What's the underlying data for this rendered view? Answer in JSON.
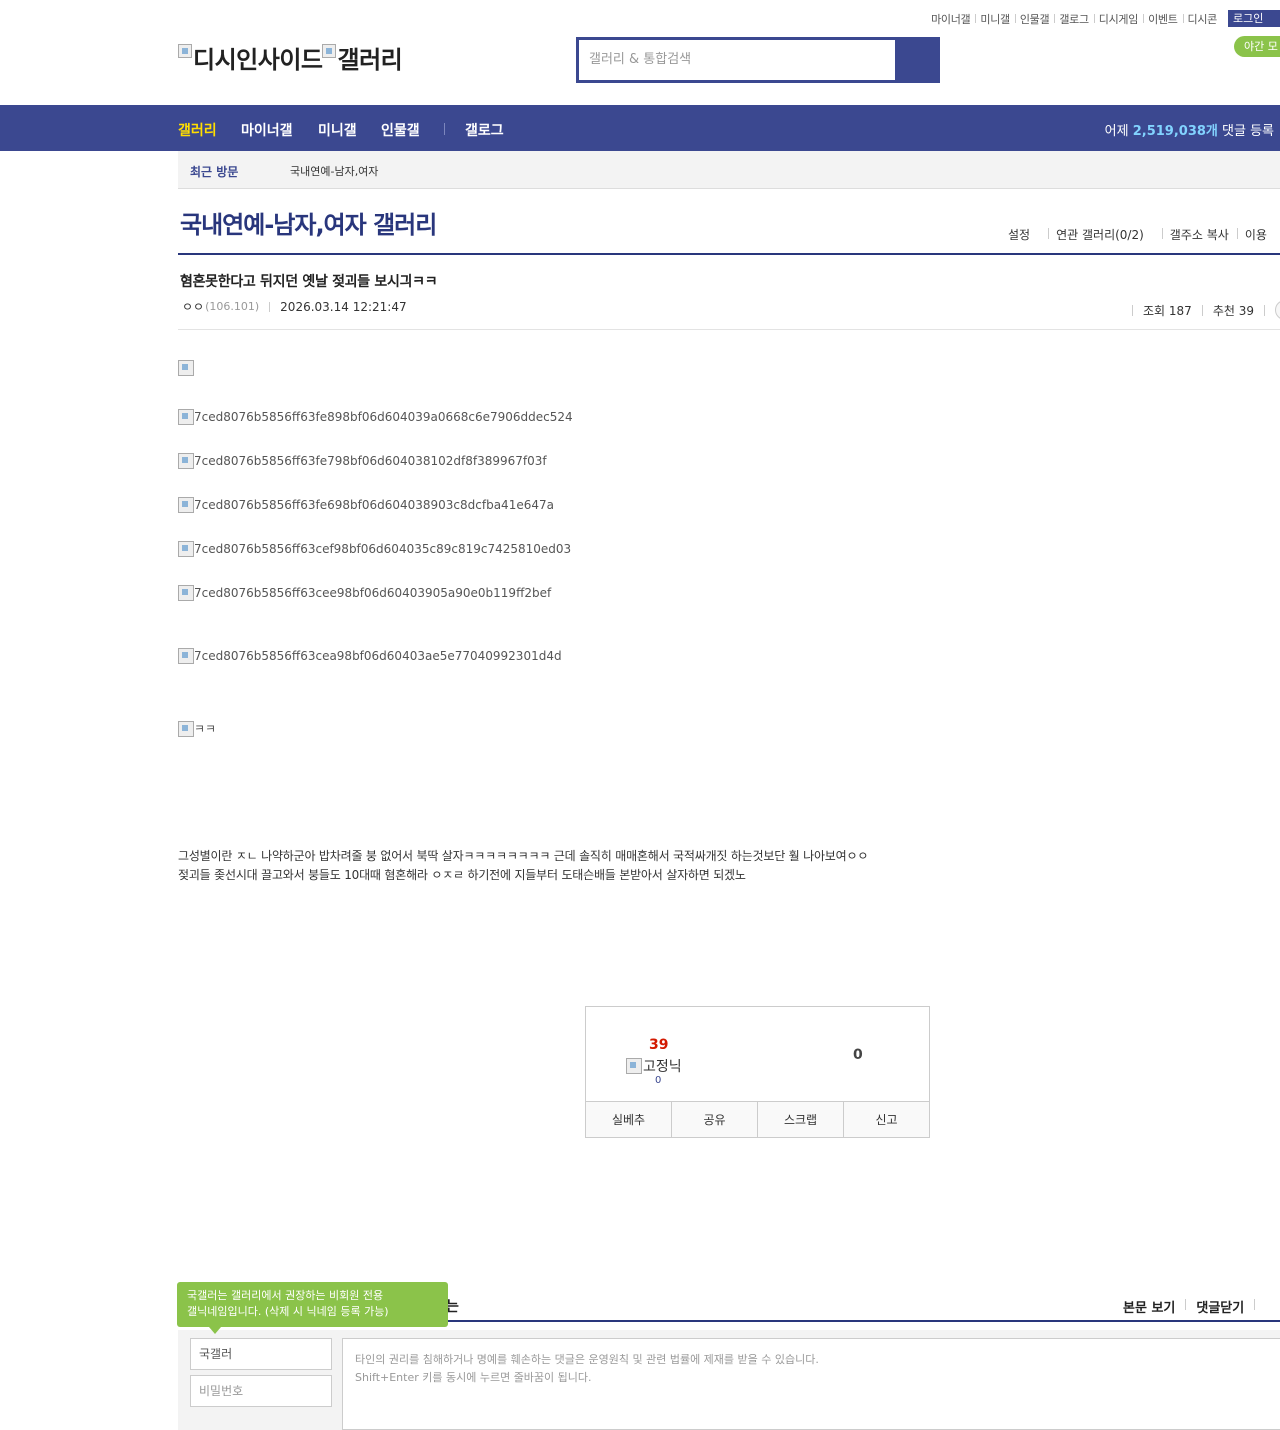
{
  "util": {
    "links": [
      "마이너갤",
      "미니갤",
      "인물갤",
      "갤로그",
      "디시게임",
      "이벤트",
      "디시콘"
    ],
    "login": "로그인",
    "night": "야간 모"
  },
  "logo": {
    "site": "디시인사이드",
    "gallery": "갤러리"
  },
  "search": {
    "placeholder": "갤러리 & 통합검색"
  },
  "nav": {
    "items": [
      "갤러리",
      "마이너갤",
      "미니갤",
      "인물갤",
      "갤로그"
    ],
    "stat_prefix": "어제 ",
    "stat_count": "2,519,038개",
    "stat_suffix": " 댓글 등록"
  },
  "recent": {
    "label": "최근 방문",
    "item": "국내연예-남자,여자"
  },
  "gallery": {
    "title": "국내연예-남자,여자 갤러리",
    "options": [
      "설정",
      "연관 갤러리(0/2)",
      "갤주소 복사",
      "이용"
    ]
  },
  "post": {
    "title": "혐혼못한다고 뒤지던 옛날 젖괴들 보시긔ㅋㅋ",
    "author": "ㅇㅇ",
    "ip": "(106.101)",
    "date": "2026.03.14 12:21:47",
    "views": "조회 187",
    "recommend": "추천 39",
    "images": [
      "7ced8076b5856ff63fe898bf06d604039a0668c6e7906ddec524",
      "7ced8076b5856ff63fe798bf06d604038102df8f389967f03f",
      "7ced8076b5856ff63fe698bf06d604038903c8dcfba41e647a",
      "7ced8076b5856ff63cef98bf06d604035c89c819c7425810ed03",
      "7ced8076b5856ff63cee98bf06d60403905a90e0b119ff2bef",
      "7ced8076b5856ff63cea98bf06d60403ae5e77040992301d4d",
      "ㅋㅋ"
    ],
    "body": [
      "그성별이란 ㅈㄴ 나약하군아 밥차려줄 붕 없어서 북딱 살자ㅋㅋㅋㅋㅋㅋㅋㅋ 근데 솔직히 매매혼해서 국적싸개짓 하는것보단 훨 나아보여ㅇㅇ",
      "젖괴들 좆선시대 끌고와서 붕들도 10대때 혐혼해라 ㅇㅈㄹ 하기전에 지들부터 도태슨배들 본받아서 살자하면 되겠노"
    ]
  },
  "recbox": {
    "up": "39",
    "fixed_label": "고정닉",
    "fixed_count": "0",
    "down": "0",
    "actions": [
      "실베추",
      "공유",
      "스크랩",
      "신고"
    ]
  },
  "comments": {
    "tooltip_line1": "국갤러는 갤러리에서 권장하는 비회원 전용",
    "tooltip_line2": "갤닉네임입니다. (삭제 시 닉네임 등록 가능)",
    "title_tail": "는",
    "links": [
      "본문 보기",
      "댓글닫기"
    ],
    "nick": "국갤러",
    "pw_placeholder": "비밀번호",
    "notice1": "타인의 권리를 침해하거나 명예를 훼손하는 댓글은 운영원칙 및 관련 법률에 제재를 받을 수 있습니다.",
    "notice2": "Shift+Enter 키를 동시에 누르면 줄바꿈이 됩니다."
  }
}
